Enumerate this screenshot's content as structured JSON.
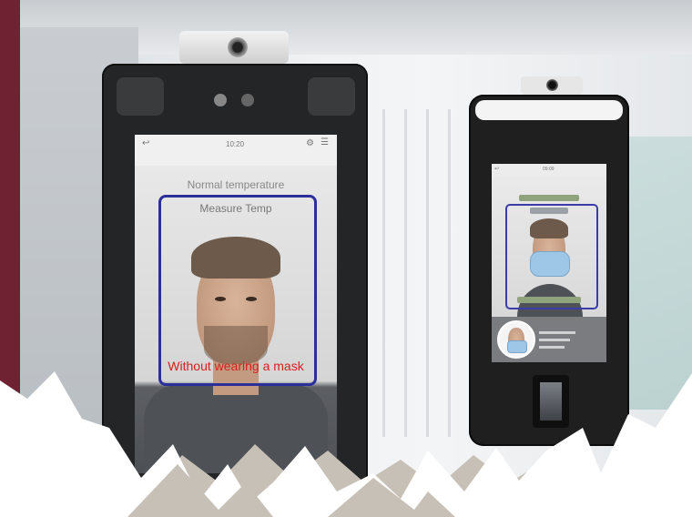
{
  "device_large": {
    "status_time": "10:20",
    "screen_title": "Normal temperature",
    "measure_label": "Measure Temp",
    "warning_text": "Without wearing a mask"
  },
  "device_small": {
    "status_time": "09:09"
  },
  "colors": {
    "brand_maroon": "#6e2232",
    "warning_red": "#d81e1e",
    "face_box_blue": "#2b2f9a",
    "mountain_white": "#ffffff",
    "mountain_taupe": "#c7c0b6"
  }
}
